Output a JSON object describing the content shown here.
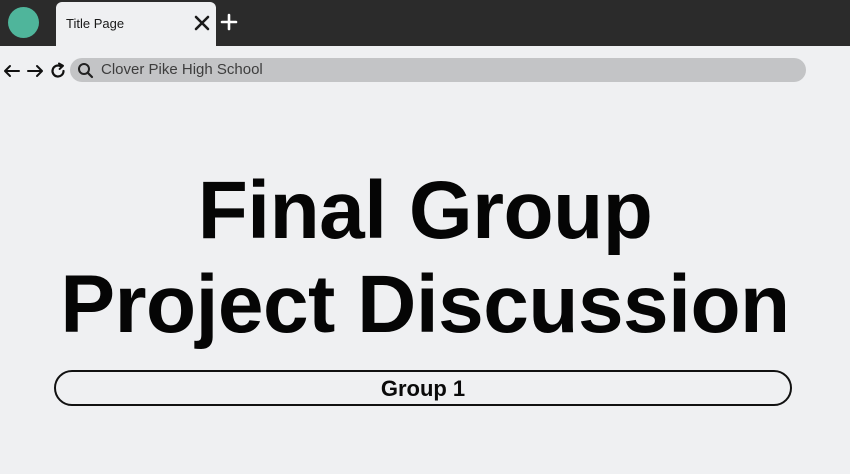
{
  "browser": {
    "tab": {
      "title": "Title Page"
    },
    "address_bar": {
      "text": "Clover Pike High School"
    },
    "colors": {
      "titlebar": "#2b2b2b",
      "app_dot": "#4fb59b",
      "address_bar_bg": "#c3c4c6",
      "page_bg": "#eff0f2"
    },
    "icons": {
      "back": "arrow-left-icon",
      "forward": "arrow-right-icon",
      "reload": "reload-icon",
      "search": "search-icon",
      "close": "close-icon",
      "new_tab": "plus-icon"
    }
  },
  "slide": {
    "title_line1": "Final Group",
    "title_line2": "Project Discussion",
    "group_label": "Group 1"
  }
}
